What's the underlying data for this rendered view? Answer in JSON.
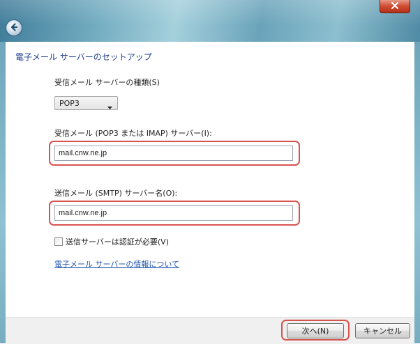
{
  "window": {
    "back_icon": "back-arrow-icon",
    "close_label": "x",
    "accent_color": "#d8524e"
  },
  "page": {
    "title": "電子メール サーバーのセットアップ"
  },
  "incoming_type": {
    "label": "受信メール サーバーの種類(S)",
    "selected": "POP3"
  },
  "incoming_server": {
    "label": "受信メール (POP3 または IMAP) サーバー(I):",
    "value": "mail.cnw.ne.jp"
  },
  "outgoing_server": {
    "label": "送信メール (SMTP) サーバー名(O):",
    "value": "mail.cnw.ne.jp"
  },
  "auth": {
    "label": "送信サーバーは認証が必要(V)",
    "checked": false
  },
  "help_link": "電子メール サーバーの情報について",
  "footer": {
    "next_label": "次へ(N)",
    "cancel_label": "キャンセル"
  }
}
